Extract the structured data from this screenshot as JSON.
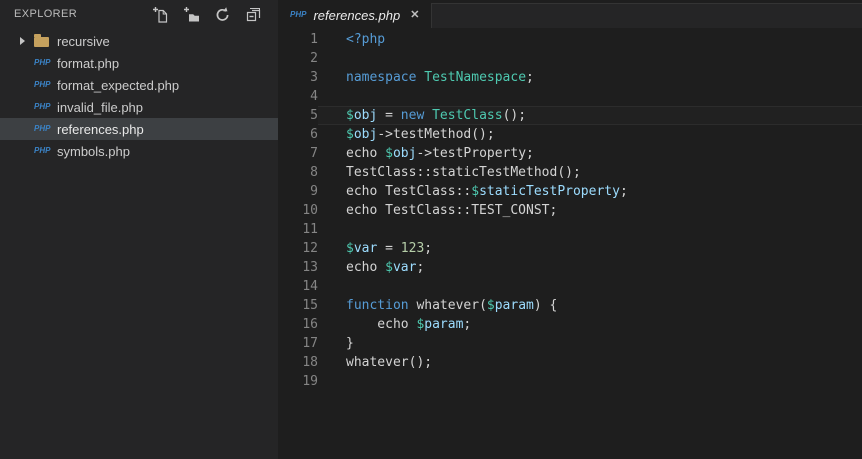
{
  "colors": {
    "editor_bg": "#1E1E1E",
    "sidebar_bg": "#252526",
    "selection_bg": "#3D4043",
    "keyword": "#569CD6",
    "type": "#4EC9B0",
    "variable": "#9CDCFE",
    "sigil": "#4EC9B0",
    "number": "#B5CEA8",
    "text": "#D4D4D4",
    "line_number": "#858585",
    "php_icon_blue": "#3B83C6",
    "folder_tan": "#C5A15E",
    "icon_gray": "#C5C5C5"
  },
  "icons": {
    "php_badge": "PHP"
  },
  "sidebar": {
    "title": "EXPLORER",
    "actions": [
      {
        "name": "new-file",
        "label": "New File"
      },
      {
        "name": "new-folder",
        "label": "New Folder"
      },
      {
        "name": "refresh",
        "label": "Refresh"
      },
      {
        "name": "collapse-all",
        "label": "Collapse All"
      }
    ],
    "items": [
      {
        "label": "recursive",
        "type": "folder",
        "expanded": false,
        "selected": false
      },
      {
        "label": "format.php",
        "type": "php",
        "selected": false
      },
      {
        "label": "format_expected.php",
        "type": "php",
        "selected": false
      },
      {
        "label": "invalid_file.php",
        "type": "php",
        "selected": false
      },
      {
        "label": "references.php",
        "type": "php",
        "selected": true
      },
      {
        "label": "symbols.php",
        "type": "php",
        "selected": false
      }
    ]
  },
  "tab": {
    "label": "references.php",
    "close": "✕"
  },
  "editor": {
    "language": "php",
    "lines": [
      {
        "num": 1,
        "current": false,
        "tokens": [
          {
            "t": "<?php",
            "c": "kw"
          }
        ]
      },
      {
        "num": 2,
        "current": false,
        "tokens": []
      },
      {
        "num": 3,
        "current": false,
        "tokens": [
          {
            "t": "namespace ",
            "c": "kw"
          },
          {
            "t": "TestNamespace",
            "c": "type"
          },
          {
            "t": ";",
            "c": "def"
          }
        ]
      },
      {
        "num": 4,
        "current": false,
        "tokens": []
      },
      {
        "num": 5,
        "current": true,
        "tokens": [
          {
            "t": "$",
            "c": "sig"
          },
          {
            "t": "obj",
            "c": "var"
          },
          {
            "t": " = ",
            "c": "def"
          },
          {
            "t": "new",
            "c": "kw"
          },
          {
            "t": " ",
            "c": "def"
          },
          {
            "t": "TestClass",
            "c": "type"
          },
          {
            "t": "();",
            "c": "def"
          }
        ]
      },
      {
        "num": 6,
        "current": false,
        "tokens": [
          {
            "t": "$",
            "c": "sig"
          },
          {
            "t": "obj",
            "c": "var"
          },
          {
            "t": "->testMethod();",
            "c": "def"
          }
        ]
      },
      {
        "num": 7,
        "current": false,
        "tokens": [
          {
            "t": "echo ",
            "c": "def"
          },
          {
            "t": "$",
            "c": "sig"
          },
          {
            "t": "obj",
            "c": "var"
          },
          {
            "t": "->testProperty;",
            "c": "def"
          }
        ]
      },
      {
        "num": 8,
        "current": false,
        "tokens": [
          {
            "t": "TestClass::staticTestMethod();",
            "c": "def"
          }
        ]
      },
      {
        "num": 9,
        "current": false,
        "tokens": [
          {
            "t": "echo TestClass::",
            "c": "def"
          },
          {
            "t": "$",
            "c": "sig"
          },
          {
            "t": "staticTestProperty",
            "c": "var"
          },
          {
            "t": ";",
            "c": "def"
          }
        ]
      },
      {
        "num": 10,
        "current": false,
        "tokens": [
          {
            "t": "echo TestClass::TEST_CONST;",
            "c": "def"
          }
        ]
      },
      {
        "num": 11,
        "current": false,
        "tokens": []
      },
      {
        "num": 12,
        "current": false,
        "tokens": [
          {
            "t": "$",
            "c": "sig"
          },
          {
            "t": "var",
            "c": "var"
          },
          {
            "t": " = ",
            "c": "def"
          },
          {
            "t": "123",
            "c": "num"
          },
          {
            "t": ";",
            "c": "def"
          }
        ]
      },
      {
        "num": 13,
        "current": false,
        "tokens": [
          {
            "t": "echo ",
            "c": "def"
          },
          {
            "t": "$",
            "c": "sig"
          },
          {
            "t": "var",
            "c": "var"
          },
          {
            "t": ";",
            "c": "def"
          }
        ]
      },
      {
        "num": 14,
        "current": false,
        "tokens": []
      },
      {
        "num": 15,
        "current": false,
        "tokens": [
          {
            "t": "function",
            "c": "kw"
          },
          {
            "t": " whatever(",
            "c": "def"
          },
          {
            "t": "$",
            "c": "sig"
          },
          {
            "t": "param",
            "c": "var"
          },
          {
            "t": ") {",
            "c": "def"
          }
        ]
      },
      {
        "num": 16,
        "current": false,
        "tokens": [
          {
            "t": "    echo ",
            "c": "def"
          },
          {
            "t": "$",
            "c": "sig"
          },
          {
            "t": "param",
            "c": "var"
          },
          {
            "t": ";",
            "c": "def"
          }
        ]
      },
      {
        "num": 17,
        "current": false,
        "tokens": [
          {
            "t": "}",
            "c": "def"
          }
        ]
      },
      {
        "num": 18,
        "current": false,
        "tokens": [
          {
            "t": "whatever();",
            "c": "def"
          }
        ]
      },
      {
        "num": 19,
        "current": false,
        "tokens": []
      }
    ]
  }
}
